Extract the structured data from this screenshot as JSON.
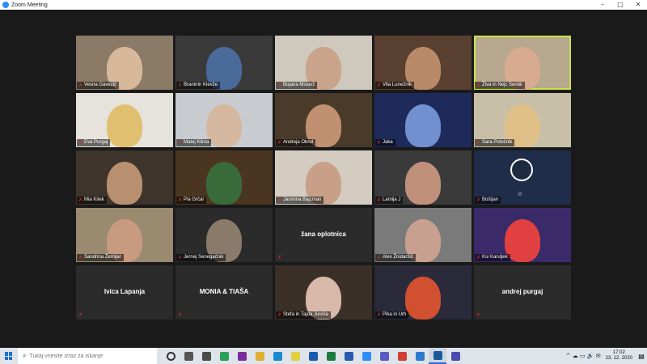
{
  "window": {
    "title": "Zoom Meeting",
    "controls": {
      "minimize": "–",
      "maximize": "□",
      "close": "✕"
    }
  },
  "colors": {
    "active_speaker": "#c8e34a",
    "mic_off": "#e02828",
    "tile_bg": "#2b2b2b",
    "zoom_blue": "#2d8cff"
  },
  "participants": [
    {
      "name": "Vesna Gavezič",
      "video": true,
      "bg": "#8a7a66",
      "face": "#d8b89a",
      "active": false
    },
    {
      "name": "Branimir Klevže",
      "video": true,
      "bg": "#3a3a3a",
      "face": "#4a6a9a",
      "active": false
    },
    {
      "name": "Bojana Mstavž",
      "video": true,
      "bg": "#cfc8bc",
      "face": "#c9a38a",
      "active": false
    },
    {
      "name": "Vita Lunežnik",
      "video": true,
      "bg": "#5a4030",
      "face": "#b88a6a",
      "active": false
    },
    {
      "name": "Živa in Nejc Senbil",
      "video": true,
      "bg": "#b8a890",
      "face": "#d8aa90",
      "active": true
    },
    {
      "name": "Eva Purgaj",
      "video": true,
      "bg": "#e6e2dc",
      "face": "#e0c070",
      "active": false
    },
    {
      "name": "Matej Klima",
      "video": true,
      "bg": "#c8ccd0",
      "face": "#d6b8a0",
      "active": false
    },
    {
      "name": "Andreja Obrul",
      "video": true,
      "bg": "#4a3a2a",
      "face": "#c09070",
      "active": false
    },
    {
      "name": "Jaka",
      "video": true,
      "bg": "#1e2a5a",
      "face": "#7090d0",
      "active": false
    },
    {
      "name": "Sara Potočnik",
      "video": true,
      "bg": "#c8bfa8",
      "face": "#e0c088",
      "active": false
    },
    {
      "name": "Mia Kitek",
      "video": true,
      "bg": "#3e342c",
      "face": "#b89070",
      "active": false
    },
    {
      "name": "Pia Grčar",
      "video": true,
      "bg": "#4a3620",
      "face": "#3a6a3a",
      "active": false
    },
    {
      "name": "Jasmina Bajcman",
      "video": true,
      "bg": "#d4ccc0",
      "face": "#c8a088",
      "active": false
    },
    {
      "name": "Lamija J",
      "video": true,
      "bg": "#3a3a3a",
      "face": "#c0907a",
      "active": false
    },
    {
      "name": "Boštjan",
      "video": false,
      "logo": true,
      "bg": "#1f2d4a",
      "face": "",
      "active": false
    },
    {
      "name": "Sandrina Žemljar",
      "video": true,
      "bg": "#9a8a70",
      "face": "#c89a80",
      "active": false
    },
    {
      "name": "Jernej Senegačnik",
      "video": true,
      "bg": "#2b2b2b",
      "face": "#8a7a6a",
      "active": false
    },
    {
      "name": "žana oplotnica",
      "video": false,
      "bg": "#2b2b2b",
      "face": "",
      "active": false
    },
    {
      "name": "Alex Žnidaršič",
      "video": true,
      "bg": "#7a7a7a",
      "face": "#c8a090",
      "active": false
    },
    {
      "name": "Ksi Karuljek",
      "video": true,
      "bg": "#3a2a6a",
      "face": "#e04040",
      "active": false
    },
    {
      "name": "Ivica Lapanja",
      "video": false,
      "bg": "#2b2b2b",
      "face": "",
      "active": false
    },
    {
      "name": "MONIA & TIAŠA",
      "video": false,
      "bg": "#2b2b2b",
      "face": "",
      "active": false
    },
    {
      "name": "Stefa in Tajda Jureša",
      "video": true,
      "bg": "#3a3028",
      "face": "#d8b8a8",
      "active": false
    },
    {
      "name": "Pika in Urh",
      "video": true,
      "bg": "#2a2a3a",
      "face": "#d05030",
      "active": false
    },
    {
      "name": "andrej purgaj",
      "video": false,
      "bg": "#2b2b2b",
      "face": "",
      "active": false
    }
  ],
  "taskbar": {
    "search_placeholder": "Tukaj vnesite izraz za iskanje",
    "apps": [
      {
        "icon": "cortana-icon",
        "color": "#333333"
      },
      {
        "icon": "task-view-icon",
        "color": "#555555"
      },
      {
        "icon": "store-icon",
        "color": "#4a4a4a"
      },
      {
        "icon": "chrome-icon",
        "color": "#2aa05a"
      },
      {
        "icon": "onenote-icon",
        "color": "#7a2a9a"
      },
      {
        "icon": "file-explorer-icon",
        "color": "#e0b030"
      },
      {
        "icon": "edge-icon",
        "color": "#1a8ad0"
      },
      {
        "icon": "sticky-notes-icon",
        "color": "#e0d040"
      },
      {
        "icon": "outlook-icon",
        "color": "#1a5ab0"
      },
      {
        "icon": "excel-icon",
        "color": "#1e7a3e"
      },
      {
        "icon": "word-icon",
        "color": "#2a5ab0"
      },
      {
        "icon": "zoom-icon",
        "color": "#2d8cff"
      },
      {
        "icon": "teams-icon",
        "color": "#5a5ac0"
      },
      {
        "icon": "google-chrome-icon",
        "color": "#d04030"
      },
      {
        "icon": "download-icon",
        "color": "#2a7ad0"
      },
      {
        "icon": "photos-icon",
        "color": "#1a5a9a"
      },
      {
        "icon": "teams-icon-2",
        "color": "#4a4ab0"
      }
    ],
    "clock_time": "17:02",
    "clock_date": "23. 12. 2020",
    "tray_glyphs": "^ ☁ ▭ 🔊 ✉"
  }
}
